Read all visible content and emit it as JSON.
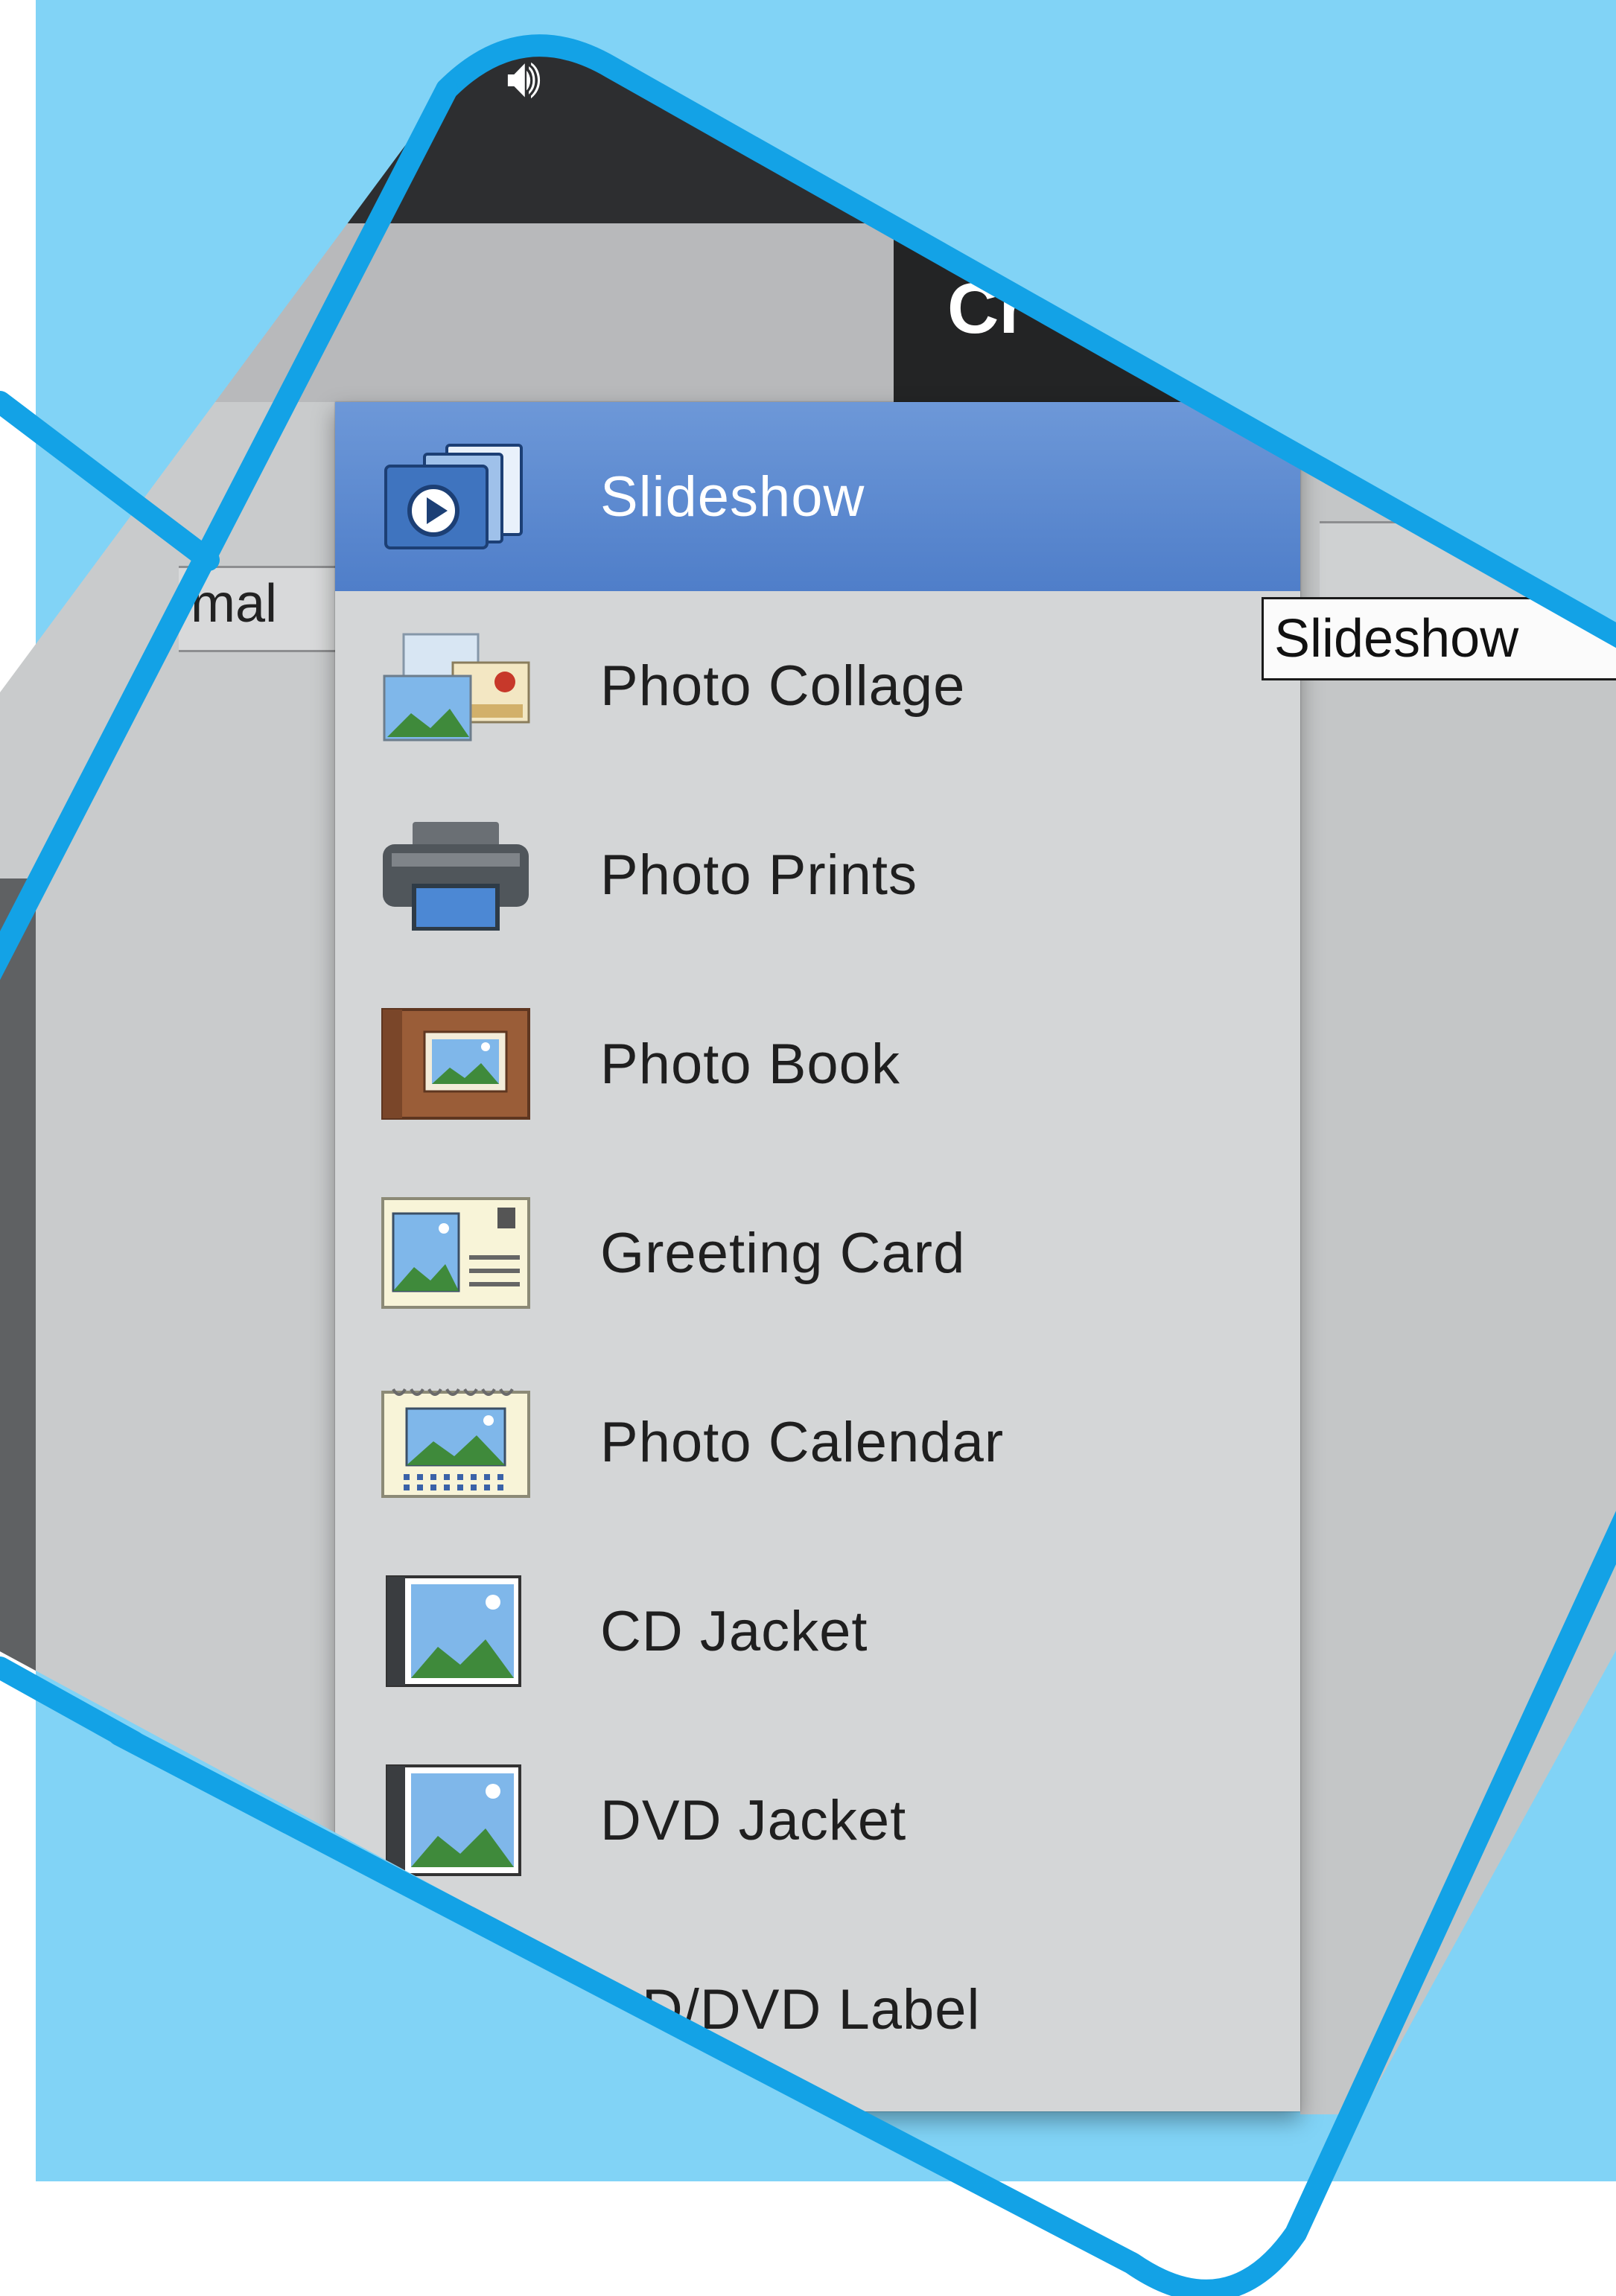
{
  "colors": {
    "backdrop": "#81d3f6",
    "frame": "#13a2e6",
    "menu_bg": "#d4d6d7",
    "selected_bg": "#5a88cf"
  },
  "header": {
    "sound_icon": "speaker-icon",
    "create_label": "Cr"
  },
  "left": {
    "mode_label": "mal"
  },
  "tooltip": {
    "text": "Slideshow"
  },
  "menu": {
    "items": [
      {
        "label": "Slideshow",
        "icon": "slideshow-icon",
        "selected": true
      },
      {
        "label": "Photo Collage",
        "icon": "photo-collage-icon",
        "selected": false
      },
      {
        "label": "Photo Prints",
        "icon": "printer-icon",
        "selected": false
      },
      {
        "label": "Photo Book",
        "icon": "photo-book-icon",
        "selected": false
      },
      {
        "label": "Greeting Card",
        "icon": "greeting-card-icon",
        "selected": false
      },
      {
        "label": "Photo Calendar",
        "icon": "calendar-icon",
        "selected": false
      },
      {
        "label": "CD Jacket",
        "icon": "cd-jacket-icon",
        "selected": false
      },
      {
        "label": "DVD Jacket",
        "icon": "dvd-jacket-icon",
        "selected": false
      },
      {
        "label": "CD/DVD Label",
        "icon": "disc-label-icon",
        "selected": false
      }
    ]
  }
}
